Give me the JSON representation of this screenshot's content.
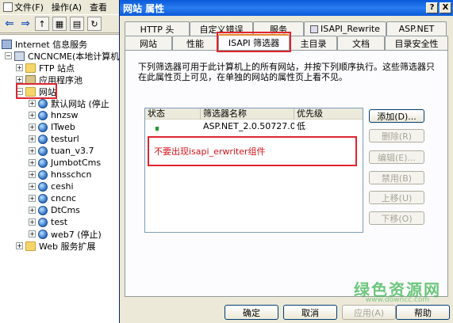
{
  "mmc": {
    "menu": [
      {
        "label": "文件(F)"
      },
      {
        "label": "操作(A)"
      },
      {
        "label": "查看"
      }
    ],
    "tree": {
      "root": "Internet 信息服务",
      "computer": "CNCNCME(本地计算机)",
      "ftp": "FTP 站点",
      "apppool": "应用程序池",
      "websites": "网站",
      "sites": [
        "默认网站 (停止",
        "hnzsw",
        "ITweb",
        "testurl",
        "tuan_v3.7",
        "JumbotCms",
        "hnsschcn",
        "ceshi",
        "cncnc",
        "DtCms",
        "test",
        "web7 (停止)"
      ],
      "webext": "Web 服务扩展"
    }
  },
  "dialog": {
    "title": "网站 属性",
    "help_glyph": "?",
    "close_glyph": "X",
    "tabs_row1": [
      {
        "label": "HTTP 头"
      },
      {
        "label": "自定义错误"
      },
      {
        "label": "服务"
      },
      {
        "label": "ISAPI_Rewrite"
      },
      {
        "label": "ASP.NET"
      }
    ],
    "tabs_row2": [
      {
        "label": "网站"
      },
      {
        "label": "性能"
      },
      {
        "label": "ISAPI 筛选器"
      },
      {
        "label": "主目录"
      },
      {
        "label": "文档"
      },
      {
        "label": "目录安全性"
      }
    ],
    "description": "下列筛选器可用于此计算机上的所有网站，并按下列顺序执行。这些筛选器只在此属性页上可见，在单独的网站的属性页上看不见。",
    "list": {
      "columns": [
        "状态",
        "筛选器名称",
        "优先级"
      ],
      "rows": [
        {
          "status_icon": "green-up-arrow-icon",
          "name": "ASP.NET_2.0.50727.0",
          "priority": "低"
        }
      ]
    },
    "annotation": "不要出现isapi_erwriter组件",
    "side_buttons": [
      {
        "label": "添加(D)...",
        "enabled": true
      },
      {
        "label": "删除(R)",
        "enabled": false
      },
      {
        "label": "编辑(E)...",
        "enabled": false
      },
      {
        "label": "禁用(B)",
        "enabled": false
      },
      {
        "label": "上移(U)",
        "enabled": false
      },
      {
        "label": "下移(O)",
        "enabled": false
      }
    ],
    "footer": [
      {
        "label": "确定"
      },
      {
        "label": "取消"
      },
      {
        "label": "应用(A)"
      },
      {
        "label": "帮助"
      }
    ]
  },
  "watermark": {
    "text": "绿色资源网",
    "url": "www.downcc.com"
  },
  "colors": {
    "title_bar": "#0a5ad9",
    "highlight_red": "#e0242f",
    "annotation_text": "#d4141c",
    "active_tab_accent": "#e68b2c"
  }
}
